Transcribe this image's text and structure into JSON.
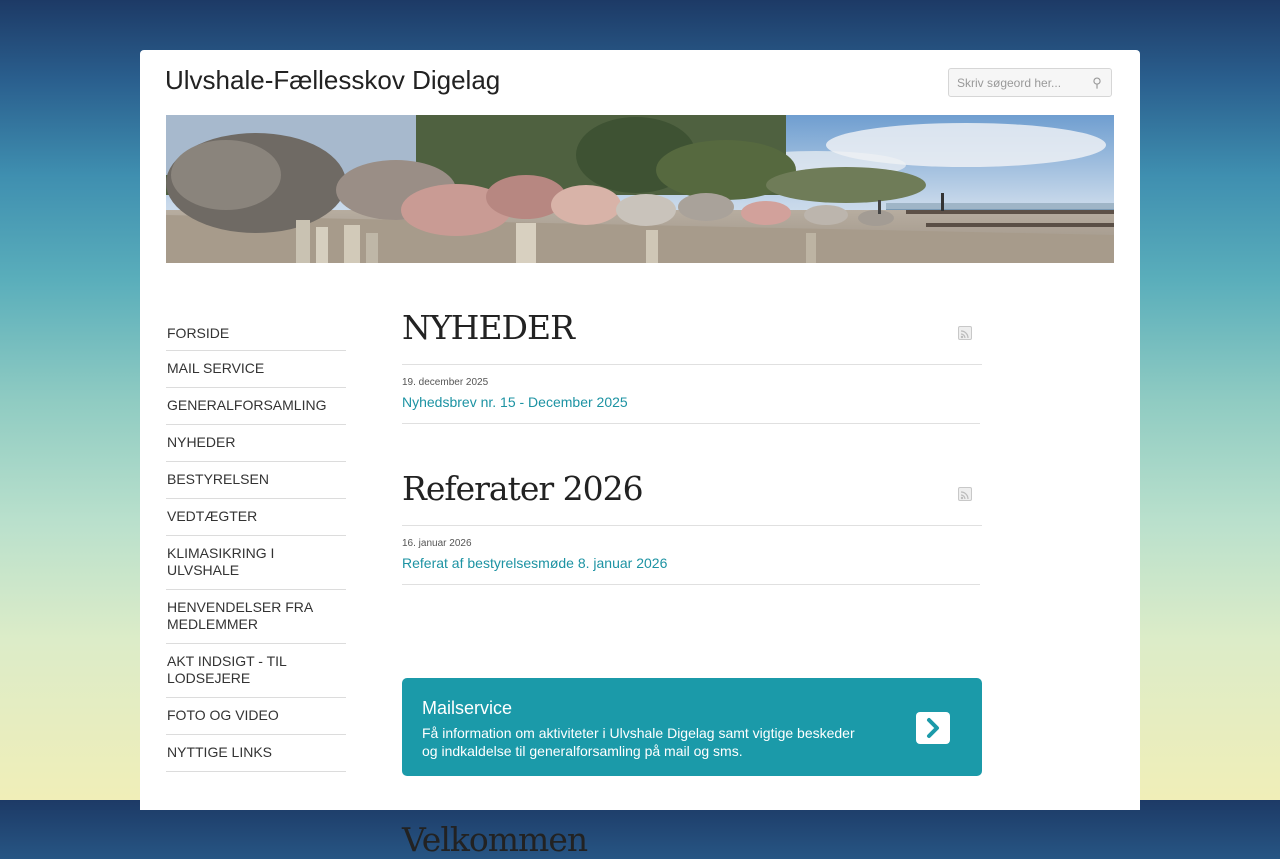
{
  "site": {
    "title": "Ulvshale-Fællesskov Digelag"
  },
  "search": {
    "placeholder": "Skriv søgeord her...",
    "icon": "search-icon"
  },
  "nav": {
    "items": [
      {
        "label": "FORSIDE"
      },
      {
        "label": "MAIL SERVICE"
      },
      {
        "label": "GENERALFORSAMLING"
      },
      {
        "label": "NYHEDER"
      },
      {
        "label": "BESTYRELSEN"
      },
      {
        "label": "VEDTÆGTER"
      },
      {
        "label": "KLIMASIKRING I ULVSHALE"
      },
      {
        "label": "HENVENDELSER FRA\nMEDLEMMER"
      },
      {
        "label": "AKT INDSIGT - TIL\nLODSEJERE"
      },
      {
        "label": "FOTO OG VIDEO"
      },
      {
        "label": "NYTTIGE LINKS"
      }
    ]
  },
  "sections": [
    {
      "title": "NYHEDER",
      "icon": "rss-icon",
      "entries": [
        {
          "date": "19. december 2025",
          "link": "Nyhedsbrev nr. 15 - December 2025"
        }
      ]
    },
    {
      "title": "Referater 2026",
      "icon": "rss-icon",
      "entries": [
        {
          "date": "16. januar 2026",
          "link": "Referat af bestyrelsesmøde 8. januar 2026"
        }
      ]
    }
  ],
  "mailservice": {
    "title": "Mailservice",
    "text": "Få information om aktiviteter i Ulvshale Digelag samt vigtige beskeder og indkaldelse til generalforsamling på mail og sms.",
    "icon": "chevron-right-icon"
  },
  "welcome": {
    "title": "Velkommen"
  },
  "colors": {
    "accent": "#1b9aa9",
    "link": "#1d93a3"
  }
}
